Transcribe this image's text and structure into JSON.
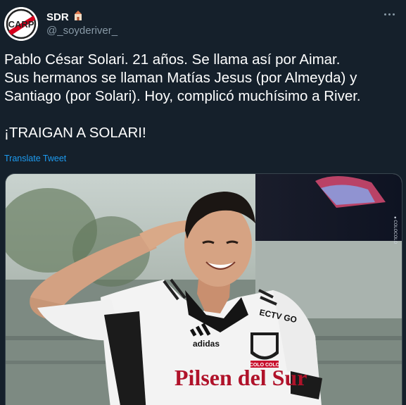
{
  "author": {
    "display_name": "SDR",
    "handle": "@_soyderiver_",
    "badge_icon": "castle-emoji-icon",
    "avatar_icon": "river-plate-crest-icon"
  },
  "tweet": {
    "lines": [
      "Pablo César Solari. 21 años. Se llama así por Aimar.",
      "Sus hermanos se llaman Matías Jesus (por Almeyda) y",
      "Santiago (por Solari). Hoy, complicó muchísimo a River.",
      "¡TRAIGAN A SOLARI!"
    ],
    "translate_label": "Translate Tweet"
  },
  "media": {
    "type": "photo",
    "shirt_sponsor": "Pilsen del Sur",
    "shirt_brand": "adidas",
    "crest_text": "COLO COLO",
    "collar_text": "ECTV GO"
  },
  "colors": {
    "background": "#15202b",
    "text": "#ffffff",
    "secondary": "#8899a6",
    "link": "#1d9bf0",
    "sponsor_red": "#b0122a"
  }
}
